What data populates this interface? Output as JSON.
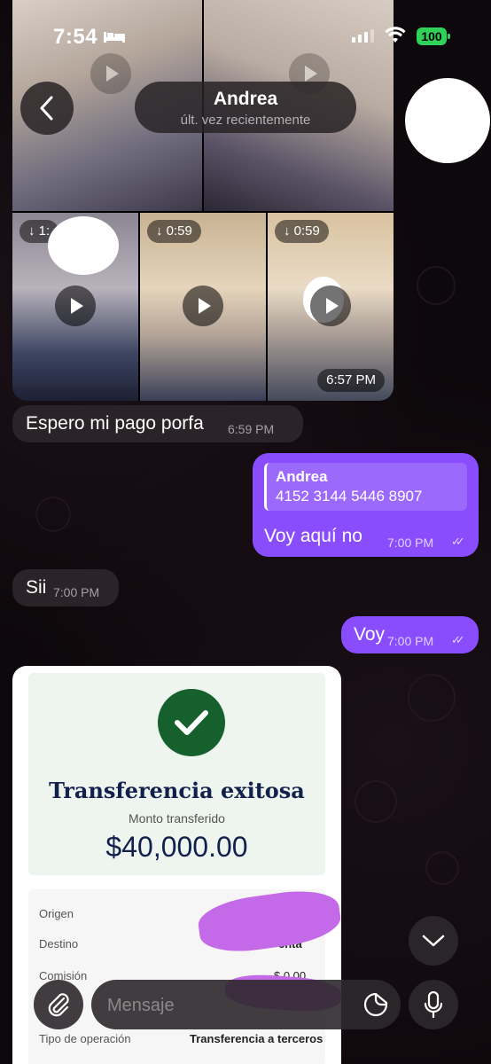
{
  "status_bar": {
    "time": "7:54",
    "battery": "100"
  },
  "header": {
    "name": "Andrea",
    "status": "últ. vez recientemente"
  },
  "media": {
    "durations": [
      "1:",
      "0:59",
      "0:59"
    ],
    "timestamp": "6:57 PM"
  },
  "messages": [
    {
      "id": "m1",
      "direction": "in",
      "text": "Espero mi pago porfa",
      "time": "6:59 PM"
    },
    {
      "id": "m2",
      "direction": "out",
      "quote_name": "Andrea",
      "quote_text": "4152 3144 5446 8907",
      "text": "Voy aquí no",
      "time": "7:00 PM",
      "read": true
    },
    {
      "id": "m3",
      "direction": "in",
      "text": "Sii",
      "time": "7:00 PM"
    },
    {
      "id": "m4",
      "direction": "out",
      "text": "Voy",
      "time": "7:00 PM",
      "read": true
    }
  ],
  "receipt": {
    "title": "Transferencia exitosa",
    "amount_label": "Monto transferido",
    "amount": "$40,000.00",
    "rows": {
      "origen": "Origen",
      "destino": "Destino",
      "destino_value": "enta",
      "comision": "Comisión",
      "comision_value": "$ 0.00",
      "tipo": "Tipo de operación",
      "tipo_value": "Transferencia a terceros"
    }
  },
  "composer": {
    "placeholder": "Mensaje"
  },
  "colors": {
    "outgoing": "#8a4dfd",
    "incoming": "#2a2428",
    "accent_green": "#16602e"
  }
}
